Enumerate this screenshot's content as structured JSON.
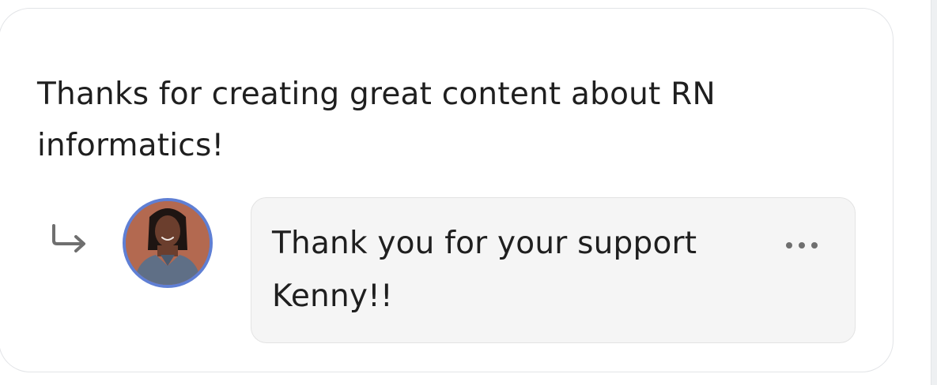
{
  "comment": {
    "text": "Thanks for creating great content about RN informatics!"
  },
  "reply": {
    "text": "Thank you for your support Kenny!!",
    "more_icon": "more-horizontal-icon",
    "reply_icon": "reply-arrow-icon"
  },
  "colors": {
    "avatar_ring": "#5f7fd4",
    "bubble_bg": "#f5f5f5",
    "text": "#1f1f1f",
    "muted_icon": "#6f6f6f"
  }
}
